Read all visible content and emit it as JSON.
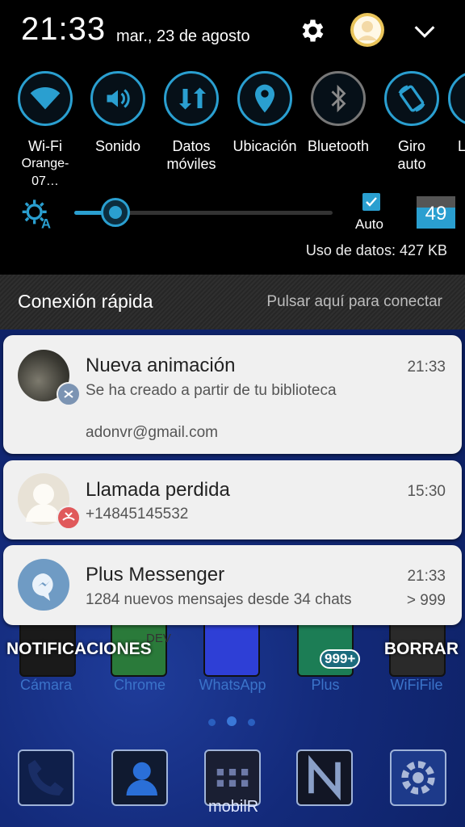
{
  "status": {
    "time": "21:33",
    "date": "mar., 23 de agosto"
  },
  "icons": {
    "settings": "gear-icon",
    "profile": "avatar",
    "collapse": "chevron-down-icon"
  },
  "quick_settings": [
    {
      "label": "Wi-Fi",
      "sub": "Orange-07…",
      "icon": "wifi-icon"
    },
    {
      "label": "Sonido",
      "sub": "",
      "icon": "sound-icon"
    },
    {
      "label": "Datos",
      "sub": "móviles",
      "icon": "mobile-data-icon"
    },
    {
      "label": "Ubicación",
      "sub": "",
      "icon": "location-icon"
    },
    {
      "label": "Bluetooth",
      "sub": "",
      "icon": "bluetooth-icon"
    },
    {
      "label": "Giro",
      "sub": "auto",
      "icon": "rotate-icon"
    },
    {
      "label": "L",
      "sub": "",
      "icon": "partial-icon"
    }
  ],
  "brightness": {
    "level": 0.16,
    "auto_label": "Auto",
    "auto_checked": true,
    "value": "49"
  },
  "data_usage": "Uso de datos: 427 KB",
  "quick_connect": {
    "title": "Conexión rápida",
    "hint": "Pulsar aquí para conectar"
  },
  "notifications": [
    {
      "title": "Nueva animación",
      "text": "Se ha creado a partir de tu biblioteca",
      "extra": "adonvr@gmail.com",
      "time": "21:33"
    },
    {
      "title": "Llamada perdida",
      "text": "+14845145532",
      "time": "15:30"
    },
    {
      "title": "Plus Messenger",
      "text": "1284 nuevos mensajes desde 34 chats",
      "time": "21:33",
      "count": "> 999"
    }
  ],
  "actions": {
    "notifications": "NOTIFICACIONES",
    "clear": "BORRAR"
  },
  "home": {
    "apps": [
      "Cámara",
      "Chrome",
      "WhatsApp",
      "Plus",
      "WiFiFile"
    ],
    "badge": "999+",
    "dock_label": "mobilR",
    "dev_label": "DEV"
  },
  "colors": {
    "accent": "#2a9fd0",
    "card": "#f0f0f0",
    "missed_call": "#e0595b"
  }
}
